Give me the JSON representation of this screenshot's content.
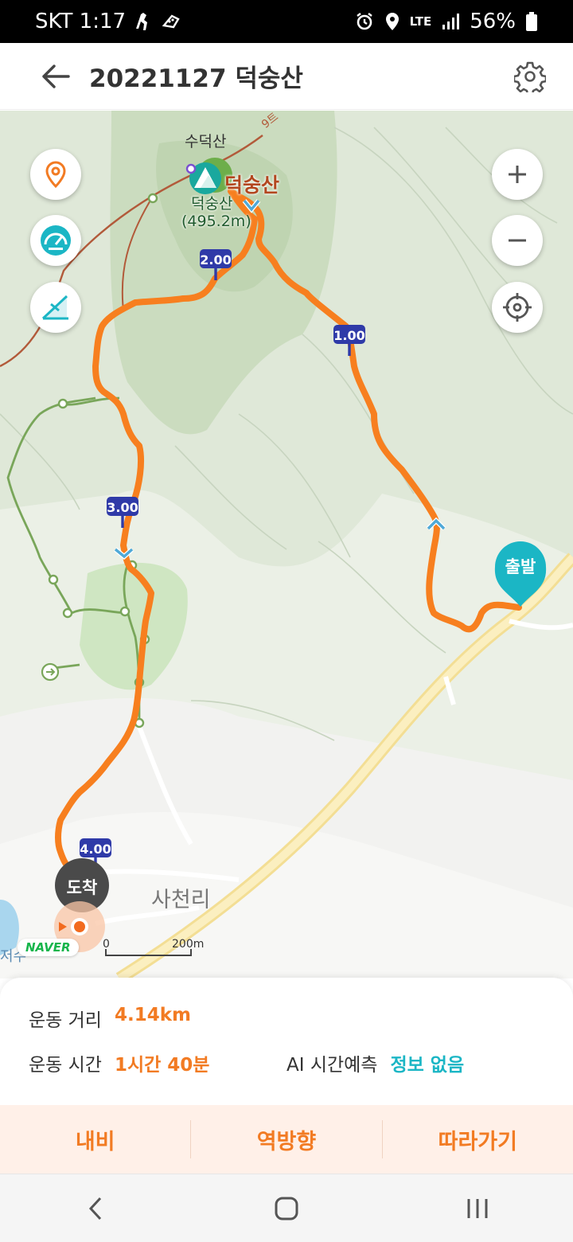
{
  "status_bar": {
    "carrier_time": "SKT 1:17",
    "network": "LTE",
    "battery": "56%"
  },
  "header": {
    "title": "20221127 덕숭산"
  },
  "map": {
    "labels": {
      "sudeoksan": "수덕산",
      "peak_name": "덕숭산",
      "peak_sub": "덕숭산",
      "peak_height": "(495.2m)",
      "village": "사천리",
      "reservoir": "저수",
      "trail": "9트"
    },
    "markers": {
      "start": "출발",
      "end": "도착",
      "km1": "1.00",
      "km2": "2.00",
      "km3": "3.00",
      "km4": "4.00"
    },
    "scale": {
      "zero": "0",
      "distance": "200m"
    },
    "logo": "NAVER",
    "colors": {
      "route": "#f77f1f",
      "accent": "#1bb6c5",
      "marker": "#2f3aa8"
    }
  },
  "summary": {
    "distance_label": "운동 거리",
    "distance_value": "4.14km",
    "time_label": "운동 시간",
    "time_value": "1시간 40분",
    "ai_label": "AI 시간예측",
    "ai_value": "정보 없음"
  },
  "actions": {
    "navi": "내비",
    "reverse": "역방향",
    "follow": "따라가기"
  }
}
